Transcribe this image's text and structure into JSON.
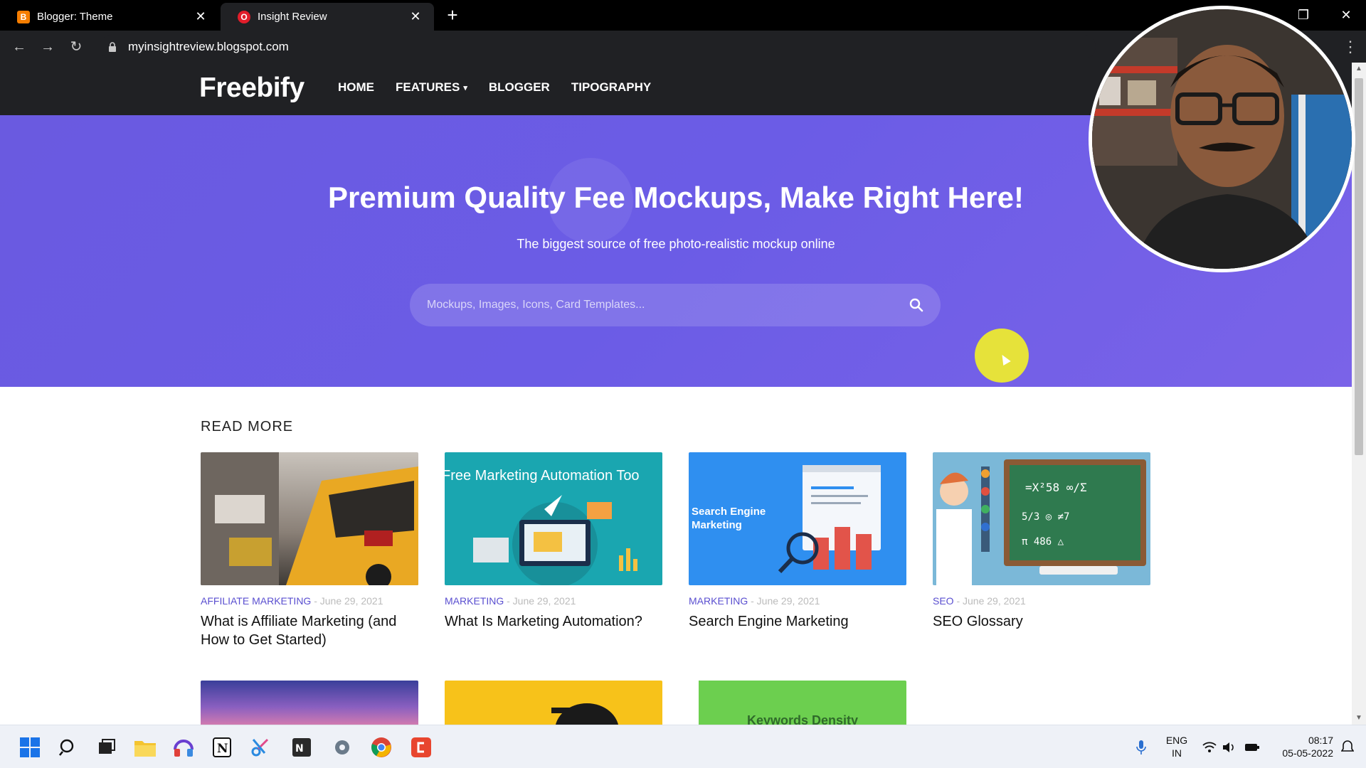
{
  "browser": {
    "tabs": [
      {
        "title": "Blogger: Theme",
        "favicon": "blogger-icon",
        "color": "#f57d00",
        "active": false
      },
      {
        "title": "Insight Review",
        "favicon": "opera-icon",
        "color": "#e11d2a",
        "active": true
      }
    ],
    "url": "myinsightreview.blogspot.com"
  },
  "site": {
    "logo": "Freebify",
    "nav": [
      "HOME",
      "FEATURES",
      "BLOGGER",
      "TIPOGRAPHY"
    ]
  },
  "hero": {
    "headline": "Premium Quality Fee Mockups, Make Right Here!",
    "subtitle": "The biggest source of free photo-realistic mockup online",
    "search_placeholder": "Mockups, Images, Icons, Card Templates..."
  },
  "read_more": {
    "heading": "READ MORE",
    "posts": [
      {
        "category": "AFFILIATE MARKETING",
        "date": " - June 29, 2021",
        "title": "What is Affiliate Marketing (and How to Get Started)"
      },
      {
        "category": "MARKETING",
        "date": " - June 29, 2021",
        "title": "What Is Marketing Automation?",
        "image_text": "Free Marketing Automation Too"
      },
      {
        "category": "MARKETING",
        "date": " - June 29, 2021",
        "title": "Search Engine Marketing",
        "image_text": "Search Engine Marketing"
      },
      {
        "category": "SEO",
        "date": " - June 29, 2021",
        "title": "SEO Glossary"
      }
    ],
    "row2_image_text": "Keywords Density"
  },
  "taskbar": {
    "lang_top": "ENG",
    "lang_bottom": "IN",
    "time": "08:17",
    "date": "05-05-2022"
  },
  "colors": {
    "hero_bg": "#6a5ae0",
    "category": "#5a4fd0",
    "cursor_highlight": "#e6e23a"
  }
}
